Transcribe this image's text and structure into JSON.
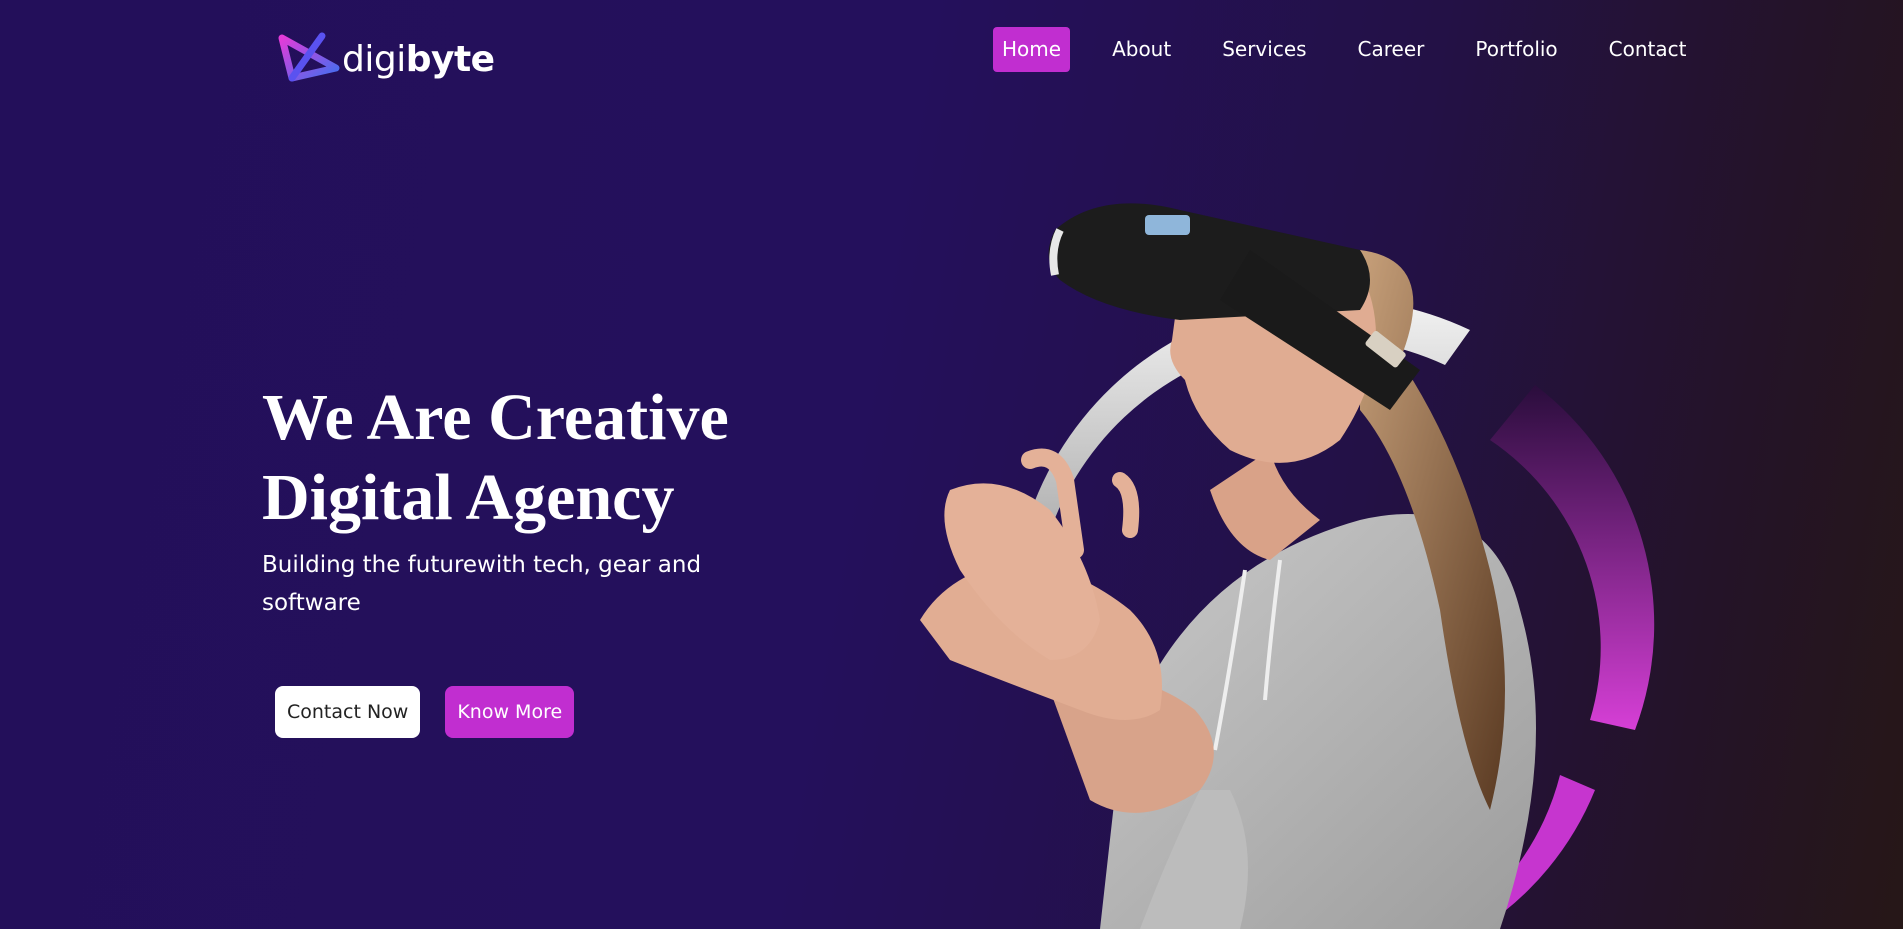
{
  "brand": {
    "name_light": "digi",
    "name_bold": "byte",
    "logo_icon": "digibyte-logo-icon",
    "colors": {
      "pink": "#e43bd8",
      "blue": "#3f6ff0"
    }
  },
  "nav": {
    "items": [
      {
        "label": "Home",
        "active": true
      },
      {
        "label": "About",
        "active": false
      },
      {
        "label": "Services",
        "active": false
      },
      {
        "label": "Career",
        "active": false
      },
      {
        "label": "Portfolio",
        "active": false
      },
      {
        "label": "Contact",
        "active": false
      }
    ]
  },
  "hero": {
    "title_line1": "We Are Creative",
    "title_line2": "Digital Agency",
    "subtitle": "Building the futurewith tech, gear and software",
    "primary_button": "Contact Now",
    "secondary_button": "Know More",
    "image": "woman-wearing-vr-headset"
  },
  "theme": {
    "background": "#24105c",
    "accent": "#c12ed0",
    "button_light": "#ffffff"
  }
}
